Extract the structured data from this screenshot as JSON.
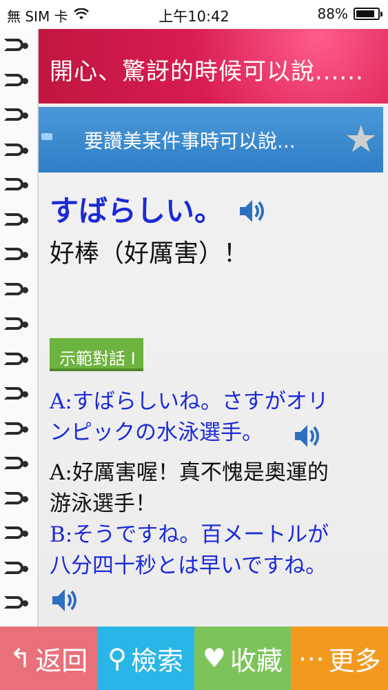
{
  "status": {
    "carrier": "無 SIM 卡",
    "time": "上午10:42",
    "battery": "88%",
    "battery_level": 0.88
  },
  "header": {
    "title": "開心、驚訝的時候可以說......"
  },
  "banner": {
    "subtitle": "要讚美某件事時可以說..."
  },
  "phrase": {
    "japanese": "すばらしい。",
    "chinese": "好棒（好厲害）！"
  },
  "example": {
    "tag": "示範對話 I",
    "lines": [
      {
        "text": "A:すばらしいね。さすがオリ"
      },
      {
        "text": "ンピックの水泳選手。"
      },
      {
        "text": "A:好厲害喔！真不愧是奧運的"
      },
      {
        "text": "游泳選手！"
      },
      {
        "text": "B:そうですね。百メートルが"
      },
      {
        "text": "八分四十秒とは早いですね。"
      }
    ]
  },
  "tabs": [
    {
      "label": "返回",
      "icon": "back-arrow-icon",
      "color": "#e8707a"
    },
    {
      "label": "檢索",
      "icon": "search-icon",
      "color": "#29b6e6"
    },
    {
      "label": "收藏",
      "icon": "heart-icon",
      "color": "#7cc45a"
    },
    {
      "label": "更多",
      "icon": "more-dots-icon",
      "color": "#f39a1e"
    }
  ]
}
